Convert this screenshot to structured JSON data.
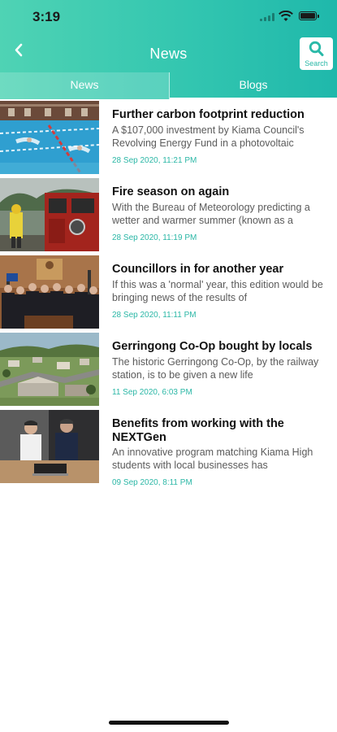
{
  "status_bar": {
    "time": "3:19"
  },
  "header": {
    "title": "News",
    "search_label": "Search",
    "icons": {
      "back": "back-arrow-icon",
      "search": "search-icon"
    },
    "colors": {
      "gradient_start": "#4fd3b4",
      "gradient_end": "#1fb8ab",
      "accent": "#2bb7a6"
    }
  },
  "tabs": [
    {
      "label": "News",
      "active": false
    },
    {
      "label": "Blogs",
      "active": true
    }
  ],
  "articles": [
    {
      "title": "Further carbon footprint reduction",
      "excerpt": "A $107,000 investment by Kiama Council's Revolving Energy Fund in a photovoltaic",
      "date": "28 Sep 2020, 11:21 PM",
      "image": "swimming-pool-photo"
    },
    {
      "title": "Fire season on again",
      "excerpt": "With the Bureau of Meteorology predicting a wetter and warmer summer (known as a",
      "date": "28 Sep 2020, 11:19 PM",
      "image": "fire-truck-photo"
    },
    {
      "title": "Councillors in for another year",
      "excerpt": "If this was a 'normal' year, this edition would be bringing news of the results of",
      "date": "28 Sep 2020, 11:11 PM",
      "image": "council-group-photo"
    },
    {
      "title": "Gerringong Co-Op bought by locals",
      "excerpt": "The historic Gerringong Co-Op, by the railway station, is to be given a new life",
      "date": "11 Sep 2020, 6:03 PM",
      "image": "aerial-town-photo"
    },
    {
      "title": "Benefits from working with the NEXTGen",
      "excerpt": "An innovative program matching Kiama High students with local businesses has",
      "date": "09 Sep 2020, 8:11 PM",
      "image": "two-men-laptop-photo"
    }
  ]
}
